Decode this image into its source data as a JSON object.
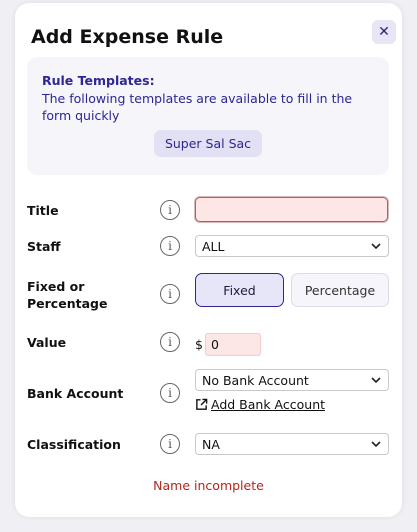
{
  "modal": {
    "title": "Add Expense Rule",
    "close_glyph": "✕"
  },
  "templates": {
    "heading": "Rule Templates:",
    "description": "The following templates are available to fill in the form quickly",
    "items": [
      "Super Sal Sac"
    ]
  },
  "form": {
    "title": {
      "label": "Title",
      "value": "",
      "info_icon": "info-icon"
    },
    "staff": {
      "label": "Staff",
      "selected": "ALL",
      "info_icon": "info-icon"
    },
    "fixed_or_percentage": {
      "label_line1": "Fixed or",
      "label_line2": "Percentage",
      "options": [
        "Fixed",
        "Percentage"
      ],
      "selected": "Fixed",
      "info_icon": "info-icon"
    },
    "value": {
      "label": "Value",
      "currency": "$",
      "value": "0",
      "info_icon": "info-icon"
    },
    "bank_account": {
      "label": "Bank Account",
      "selected": "No Bank Account",
      "add_link": "Add Bank Account",
      "info_icon": "info-icon"
    },
    "classification": {
      "label": "Classification",
      "selected": "NA",
      "info_icon": "info-icon"
    }
  },
  "validation": {
    "message": "Name incomplete"
  },
  "colors": {
    "accent": "#2d2694",
    "error": "#b3261e",
    "invalid_field_bg": "#fde6e6"
  }
}
